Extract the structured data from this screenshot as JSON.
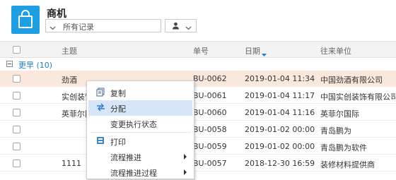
{
  "header": {
    "title": "商机",
    "filter_value": "所有记录"
  },
  "columns": {
    "subject": "主题",
    "number": "单号",
    "date": "日期",
    "company": "往来单位"
  },
  "group": {
    "label": "更早 (10)"
  },
  "rows": [
    {
      "subject": "劲酒",
      "number": "BU-0062",
      "date": "2019-01-04 11:34",
      "company": "中国劲酒有限公司",
      "selected": true
    },
    {
      "subject": "实创装饰",
      "number": "BU-0061",
      "date": "2019-01-04 11:17",
      "company": "中国实创装饰有限公司",
      "selected": false
    },
    {
      "subject": "英菲尔国际",
      "number": "BU-0060",
      "date": "2019-01-04 11:16",
      "company": "英菲尔国际",
      "selected": false
    },
    {
      "subject": "",
      "number": "BU-0058",
      "date": "2019-01-02 00:00",
      "company": "青岛鹏为",
      "selected": false
    },
    {
      "subject": "",
      "number": "BU-0059",
      "date": "2019-01-02 00:00",
      "company": "青岛鹏为软件",
      "selected": false
    },
    {
      "subject": "1111",
      "number": "BU-0057",
      "date": "2018-12-30 16:59",
      "company": "装修材料提供商",
      "selected": false
    }
  ],
  "context_menu": {
    "items": [
      {
        "label": "复制",
        "icon": "copy-icon",
        "active": false,
        "submenu": false
      },
      {
        "label": "分配",
        "icon": "assign-icon",
        "active": true,
        "submenu": false
      },
      {
        "label": "变更执行状态",
        "icon": "",
        "active": false,
        "submenu": false
      },
      {
        "label": "打印",
        "icon": "print-icon",
        "active": false,
        "submenu": false
      },
      {
        "label": "流程推进",
        "icon": "",
        "active": false,
        "submenu": true
      },
      {
        "label": "流程推进过程",
        "icon": "",
        "active": false,
        "submenu": true
      }
    ]
  },
  "colors": {
    "accent": "#1e9fe3",
    "selected_row": "#fbe8dc",
    "menu_active": "#d6e6f8",
    "group_label": "#1e7fc8"
  }
}
